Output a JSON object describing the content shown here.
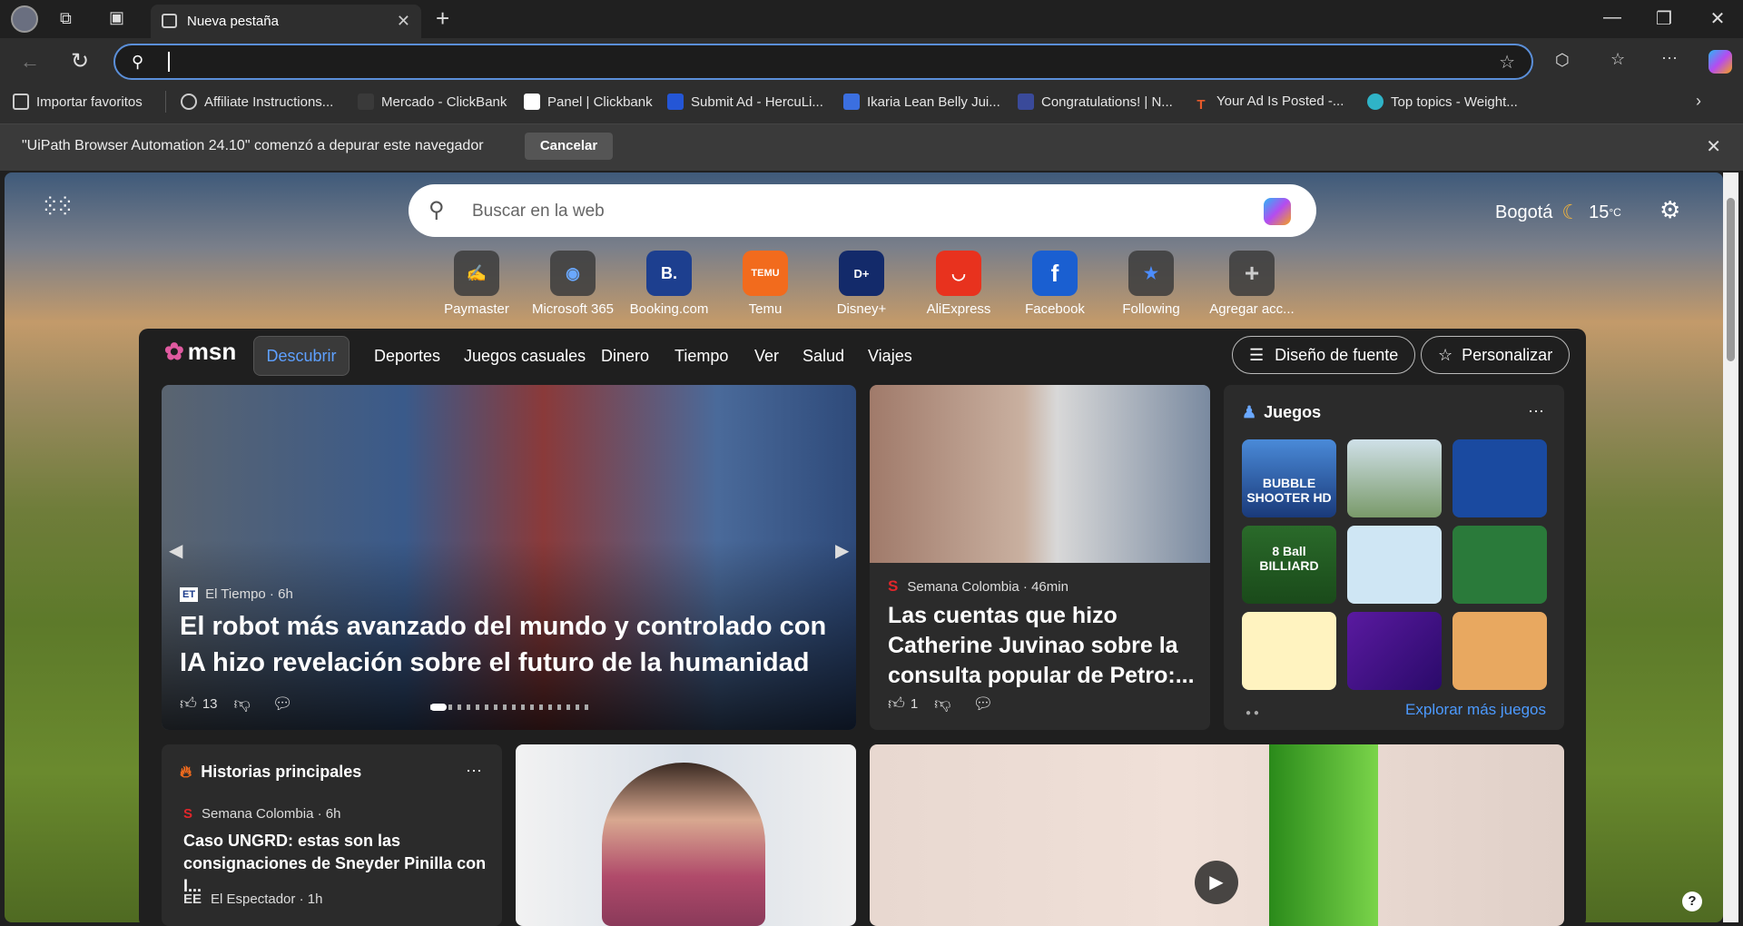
{
  "browser": {
    "tab_title": "Nueva pestaña",
    "address_value": "",
    "bookmarks": [
      {
        "label": "Importar favoritos",
        "icon": "folder-icon"
      },
      {
        "label": "Affiliate Instructions...",
        "icon": "globe-icon"
      },
      {
        "label": "Mercado - ClickBank",
        "icon": "clickbank-icon"
      },
      {
        "label": "Panel | Clickbank",
        "icon": "clickbank-icon"
      },
      {
        "label": "Submit Ad - HercuLi...",
        "icon": "hl-icon"
      },
      {
        "label": "Ikaria Lean Belly Jui...",
        "icon": "doc-icon"
      },
      {
        "label": "Congratulations! | N...",
        "icon": "site-icon"
      },
      {
        "label": "Your Ad Is Posted -...",
        "icon": "t-icon"
      },
      {
        "label": "Top topics - Weight...",
        "icon": "globe-icon"
      }
    ],
    "infobar_text": "\"UiPath Browser Automation 24.10\" comenzó a depurar este navegador",
    "infobar_cancel": "Cancelar"
  },
  "newtab": {
    "search_placeholder": "Buscar en la web",
    "weather_city": "Bogotá",
    "weather_temp": "15",
    "weather_unit": "°C",
    "quick_links": [
      {
        "label": "Paymaster",
        "glyph": "✍"
      },
      {
        "label": "Microsoft 365",
        "glyph": "◉"
      },
      {
        "label": "Booking.com",
        "glyph": "B."
      },
      {
        "label": "Temu",
        "glyph": "TEMU"
      },
      {
        "label": "Disney+",
        "glyph": "D+"
      },
      {
        "label": "AliExpress",
        "glyph": "◡"
      },
      {
        "label": "Facebook",
        "glyph": "f"
      },
      {
        "label": "Following",
        "glyph": "★"
      },
      {
        "label": "Agregar acc...",
        "glyph": "+"
      }
    ]
  },
  "msn": {
    "logo": "msn",
    "nav": [
      "Descubrir",
      "Deportes",
      "Juegos casuales",
      "Dinero",
      "Tiempo",
      "Ver",
      "Salud",
      "Viajes"
    ],
    "font_button": "Diseño de fuente",
    "personalize_button": "Personalizar",
    "hero": {
      "source": "El Tiempo",
      "age": "6h",
      "title": "El robot más avanzado del mundo y controlado con IA hizo revelación sobre el futuro de la humanidad",
      "likes": "13"
    },
    "story2": {
      "source": "Semana Colombia",
      "age": "46min",
      "title": "Las cuentas que hizo Catherine Juvinao sobre la consulta popular de Petro:...",
      "likes": "1"
    },
    "games": {
      "title": "Juegos",
      "explore": "Explorar más juegos",
      "tiles": [
        "BUBBLE SHOOTER HD",
        "",
        "",
        "8 Ball BILLIARD",
        "",
        "",
        "",
        "",
        ""
      ]
    },
    "top_stories": {
      "title": "Historias principales",
      "items": [
        {
          "source": "Semana Colombia",
          "age": "6h",
          "title": "Caso UNGRD: estas son las consignaciones de Sneyder Pinilla con l..."
        },
        {
          "source": "El Espectador",
          "age": "1h"
        }
      ]
    }
  }
}
